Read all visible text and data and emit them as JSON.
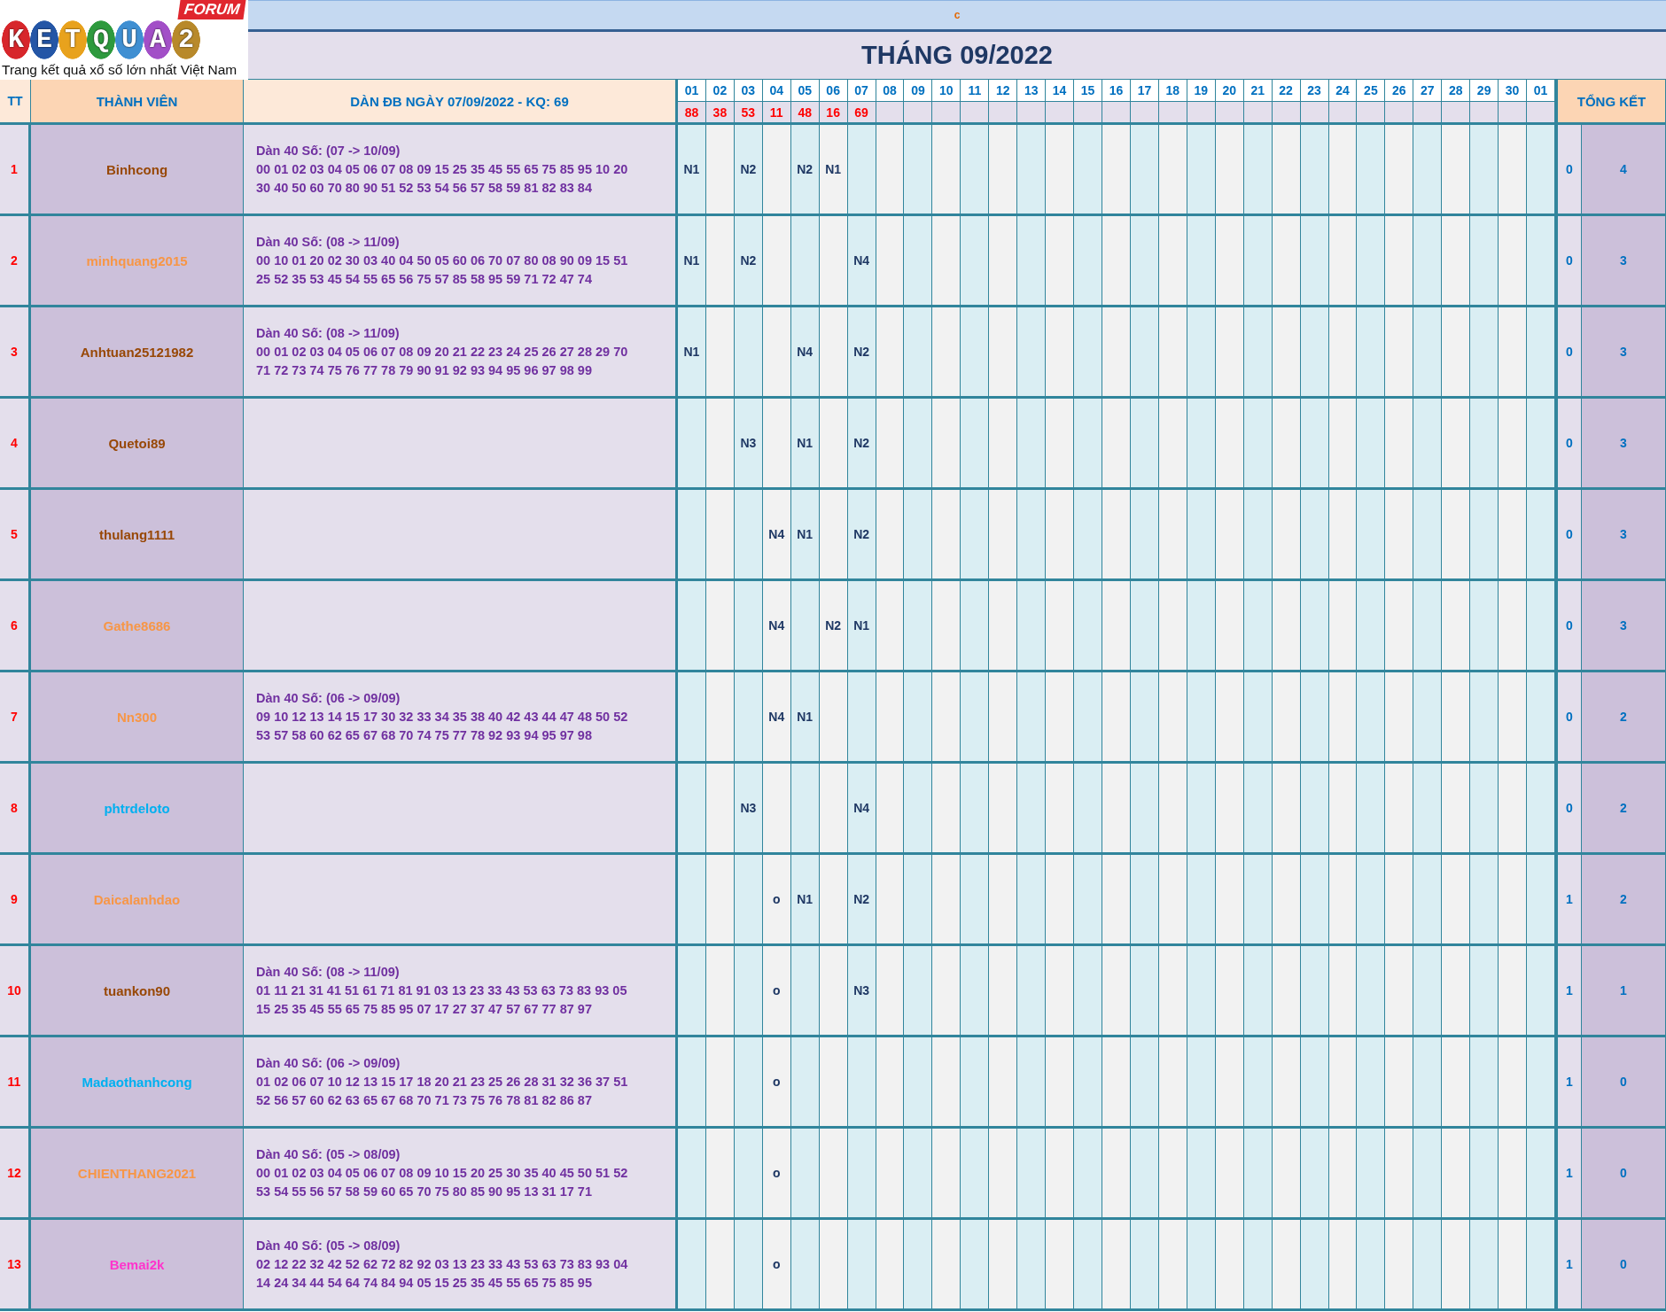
{
  "logo": {
    "letters": "KETQUA2",
    "badge": "FORUM",
    "tagline": "Trang kết quả xổ số lớn nhất Việt Nam"
  },
  "top_band": {
    "text": "c"
  },
  "title": "THÁNG 09/2022",
  "table": {
    "header": {
      "tt": "TT",
      "member": "THÀNH VIÊN",
      "dan": "DÀN ĐB NGÀY 07/09/2022 - KQ: 69",
      "summary": "TỔNG KẾT"
    },
    "days": [
      "01",
      "02",
      "03",
      "04",
      "05",
      "06",
      "07",
      "08",
      "09",
      "10",
      "11",
      "12",
      "13",
      "14",
      "15",
      "16",
      "17",
      "18",
      "19",
      "20",
      "21",
      "22",
      "23",
      "24",
      "25",
      "26",
      "27",
      "28",
      "29",
      "30",
      "01"
    ],
    "results": [
      "88",
      "38",
      "53",
      "11",
      "48",
      "16",
      "69"
    ],
    "rows": [
      {
        "tt": "1",
        "name": "Binhcong",
        "color": "#984807",
        "heading": "Dàn 40 Số: (07 -> 10/09)",
        "lines": [
          "00 01 02 03 04 05 06 07 08 09 15 25 35 45 55 65 75 85 95 10 20",
          "30 40 50 60 70 80 90 51 52 53 54 56 57 58 59 81 82 83 84"
        ],
        "cells": [
          "N1",
          null,
          "N2",
          null,
          "N2",
          "N1"
        ],
        "miss": "0",
        "total": "4"
      },
      {
        "tt": "2",
        "name": "minhquang2015",
        "color": "#f79646",
        "heading": "Dàn 40 Số: (08 -> 11/09)",
        "lines": [
          "00 10 01 20 02 30 03 40 04 50 05 60 06 70 07 80 08 90 09 15 51",
          "25 52 35 53 45 54 55 65 56 75 57 85 58 95 59 71 72 47 74"
        ],
        "cells": [
          "N1",
          null,
          "N2",
          null,
          null,
          null,
          "N4"
        ],
        "miss": "0",
        "total": "3"
      },
      {
        "tt": "3",
        "name": "Anhtuan25121982",
        "color": "#984807",
        "heading": "Dàn 40 Số: (08 -> 11/09)",
        "lines": [
          "00 01 02 03 04 05 06 07 08 09 20 21 22 23 24 25 26 27 28 29 70",
          "71 72 73 74 75 76 77 78 79 90 91 92 93 94 95 96 97 98 99"
        ],
        "cells": [
          "N1",
          null,
          null,
          null,
          "N4",
          null,
          "N2"
        ],
        "miss": "0",
        "total": "3"
      },
      {
        "tt": "4",
        "name": "Quetoi89",
        "color": "#984807",
        "cells": [
          null,
          null,
          "N3",
          null,
          "N1",
          null,
          "N2"
        ],
        "miss": "0",
        "total": "3"
      },
      {
        "tt": "5",
        "name": "thulang1111",
        "color": "#984807",
        "cells": [
          null,
          null,
          null,
          "N4",
          "N1",
          null,
          "N2"
        ],
        "miss": "0",
        "total": "3"
      },
      {
        "tt": "6",
        "name": "Gathe8686",
        "color": "#f79646",
        "cells": [
          null,
          null,
          null,
          "N4",
          null,
          "N2",
          "N1"
        ],
        "miss": "0",
        "total": "3"
      },
      {
        "tt": "7",
        "name": "Nn300",
        "color": "#f79646",
        "heading": "Dàn 40 Số: (06 -> 09/09)",
        "lines": [
          "09 10 12 13 14 15 17 30 32 33 34 35 38 40 42 43 44 47 48 50 52",
          "53 57 58 60 62 65 67 68 70 74 75 77 78 92 93 94 95 97 98"
        ],
        "cells": [
          null,
          null,
          null,
          "N4",
          "N1"
        ],
        "miss": "0",
        "total": "2"
      },
      {
        "tt": "8",
        "name": "phtrdeloto",
        "color": "#00b0f0",
        "cells": [
          null,
          null,
          "N3",
          null,
          null,
          null,
          "N4"
        ],
        "miss": "0",
        "total": "2"
      },
      {
        "tt": "9",
        "name": "Daicalanhdao",
        "color": "#f79646",
        "cells": [
          null,
          null,
          null,
          "o",
          "N1",
          null,
          "N2"
        ],
        "miss": "1",
        "total": "2"
      },
      {
        "tt": "10",
        "name": "tuankon90",
        "color": "#984807",
        "heading": "Dàn 40 Số: (08 -> 11/09)",
        "lines": [
          "01 11 21 31 41 51 61 71 81 91 03 13 23 33 43 53 63 73 83 93 05",
          "15 25 35 45 55 65 75 85 95 07 17 27 37 47 57 67 77 87 97"
        ],
        "cells": [
          null,
          null,
          null,
          "o",
          null,
          null,
          "N3"
        ],
        "miss": "1",
        "total": "1"
      },
      {
        "tt": "11",
        "name": "Madaothanhcong",
        "color": "#00b0f0",
        "heading": "Dàn 40 Số: (06 -> 09/09)",
        "lines": [
          "01 02 06 07 10 12 13 15 17 18 20 21 23 25 26 28 31 32 36 37 51",
          "52 56 57 60 62 63 65 67 68 70 71 73 75 76 78 81 82 86 87"
        ],
        "cells": [
          null,
          null,
          null,
          "o"
        ],
        "miss": "1",
        "total": "0"
      },
      {
        "tt": "12",
        "name": "CHIENTHANG2021",
        "color": "#f79646",
        "heading": "Dàn 40 Số: (05 -> 08/09)",
        "lines": [
          "00 01 02 03 04 05 06 07 08 09 10 15 20 25 30 35 40 45 50 51 52",
          "53 54 55 56 57 58 59 60 65 70 75 80 85 90 95 13 31 17 71"
        ],
        "cells": [
          null,
          null,
          null,
          "o"
        ],
        "miss": "1",
        "total": "0"
      },
      {
        "tt": "13",
        "name": "Bemai2k",
        "color": "#ff33cc",
        "heading": "Dàn 40 Số: (05 -> 08/09)",
        "lines": [
          "02 12 22 32 42 52 62 72 82 92 03 13 23 33 43 53 63 73 83 93 04",
          "14 24 34 44 54 64 74 84 94 05 15 25 35 45 55 65 75 85 95"
        ],
        "cells": [
          null,
          null,
          null,
          "o"
        ],
        "miss": "1",
        "total": "0"
      }
    ]
  }
}
